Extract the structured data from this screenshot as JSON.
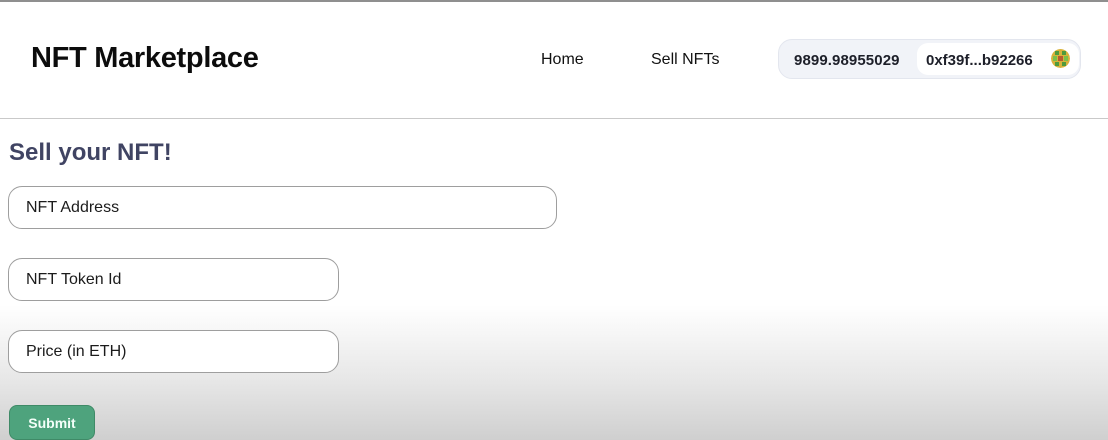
{
  "header": {
    "brand": "NFT Marketplace",
    "nav": {
      "home_label": "Home",
      "sell_label": "Sell NFTs"
    },
    "wallet": {
      "balance": "9899.98955029",
      "account": "0xf39f...b92266",
      "avatar_icon": "identicon-avatar-icon"
    }
  },
  "form": {
    "title": "Sell your NFT!",
    "nft_address": {
      "value": "",
      "placeholder": "NFT Address"
    },
    "token_id": {
      "value": "",
      "placeholder": "NFT Token Id"
    },
    "price": {
      "value": "",
      "placeholder": "Price (in ETH)"
    },
    "submit_label": "Submit"
  },
  "colors": {
    "title": "#404463",
    "submit_bg": "#4ea37d",
    "wallet_bg": "#f1f3f8"
  }
}
